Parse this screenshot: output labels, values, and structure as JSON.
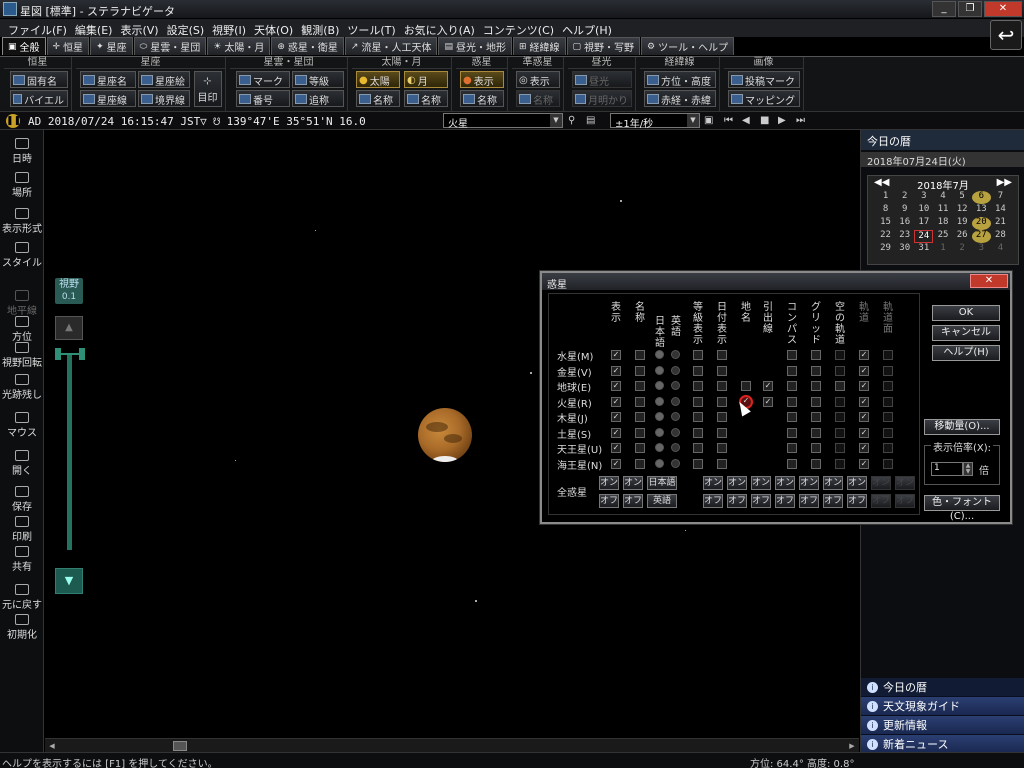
{
  "window": {
    "title": "星図 [標準] - ステラナビゲータ"
  },
  "menu": [
    "ファイル(F)",
    "編集(E)",
    "表示(V)",
    "設定(S)",
    "視野(I)",
    "天体(O)",
    "観測(B)",
    "ツール(T)",
    "お気に入り(A)",
    "コンテンツ(C)",
    "ヘルプ(H)"
  ],
  "tabs": [
    {
      "label": "全般",
      "active": true
    },
    {
      "label": "恒星"
    },
    {
      "label": "星座"
    },
    {
      "label": "星雲・星団"
    },
    {
      "label": "太陽・月"
    },
    {
      "label": "惑星・衛星"
    },
    {
      "label": "流星・人工天体"
    },
    {
      "label": "昼光・地形"
    },
    {
      "label": "経緯線"
    },
    {
      "label": "視野・写野"
    },
    {
      "label": "ツール・ヘルプ"
    }
  ],
  "ribbon": {
    "groups": [
      "恒星",
      "星座",
      "星雲・星団",
      "太陽・月",
      "惑星",
      "準惑星",
      "昼光",
      "経緯線",
      "画像"
    ],
    "buttons": {
      "fixed_name": "固有名",
      "bayer": "バイエル",
      "const_name": "星座名",
      "const_pic": "星座絵",
      "const_line": "星座線",
      "boundary": "境界線",
      "mark_btn": "目印",
      "neb_mark": "マーク",
      "neb_mag": "等級",
      "neb_num": "番号",
      "neb_extra": "追称",
      "sun": "太陽",
      "moon": "月",
      "sun_name": "名称",
      "moon_name": "名称",
      "planet_show": "表示",
      "planet_name": "名称",
      "dwarf_show": "表示",
      "dwarf_name": "名称",
      "daylight": "昼光",
      "moonlight": "月明かり",
      "azalt": "方位・高度",
      "radec": "赤経・赤緯",
      "post_mark": "投稿マーク",
      "mapping": "マッピング"
    }
  },
  "infobar": {
    "datetime": "AD 2018/07/24 16:15:47 JST▽ ☋ 139°47'E 35°51'N 16.0",
    "object": "火星",
    "speed": "±1年/秒"
  },
  "left_toolbar": [
    {
      "label": "日時"
    },
    {
      "label": "場所"
    },
    {
      "label": "表示形式"
    },
    {
      "label": "スタイル"
    },
    {
      "label": "地平線",
      "disabled": true
    },
    {
      "label": "方位"
    },
    {
      "label": "視野回転"
    },
    {
      "label": "光跡残し"
    },
    {
      "label": "マウス"
    },
    {
      "label": "開く"
    },
    {
      "label": "保存"
    },
    {
      "label": "印刷"
    },
    {
      "label": "共有"
    },
    {
      "label": "元に戻す"
    },
    {
      "label": "初期化"
    }
  ],
  "zoom": {
    "label": "視野",
    "value": "0.1"
  },
  "right_panel": {
    "header": "今日の暦",
    "date": "2018年07月24日(火)",
    "calendar": {
      "month": "2018年7月",
      "days": [
        "1",
        "2",
        "3",
        "4",
        "5",
        "6",
        "7",
        "8",
        "9",
        "10",
        "11",
        "12",
        "13",
        "14",
        "15",
        "16",
        "17",
        "18",
        "19",
        "20",
        "21",
        "22",
        "23",
        "24",
        "25",
        "26",
        "27",
        "28",
        "29",
        "30",
        "31",
        "1",
        "2",
        "3",
        "4"
      ],
      "today": "24"
    },
    "list": [
      "今日の暦",
      "天文現象ガイド",
      "更新情報",
      "新着ニュース"
    ]
  },
  "dialog": {
    "title": "惑星",
    "columns": [
      "表示",
      "名称",
      "日本語",
      "英語",
      "等級表示",
      "日付表示",
      "地名",
      "引出線",
      "コンパス",
      "グリッド",
      "空の軌道",
      "軌道",
      "軌道面"
    ],
    "rows": [
      "水星(M)",
      "金星(V)",
      "地球(E)",
      "火星(R)",
      "木星(J)",
      "土星(S)",
      "天王星(U)",
      "海王星(N)"
    ],
    "all_label": "全惑星",
    "on": "オン",
    "off": "オフ",
    "jp": "日本語",
    "en": "英語",
    "ok": "OK",
    "cancel": "キャンセル",
    "help": "ヘルプ(H)",
    "move": "移動量(O)...",
    "mag_label": "表示倍率(X):",
    "mag_value": "1",
    "mag_unit": "倍",
    "font": "色・フォント(C)..."
  },
  "status": {
    "left": "ヘルプを表示するには [F1] を押してください。",
    "right": "方位: 64.4° 高度: 0.8°"
  }
}
